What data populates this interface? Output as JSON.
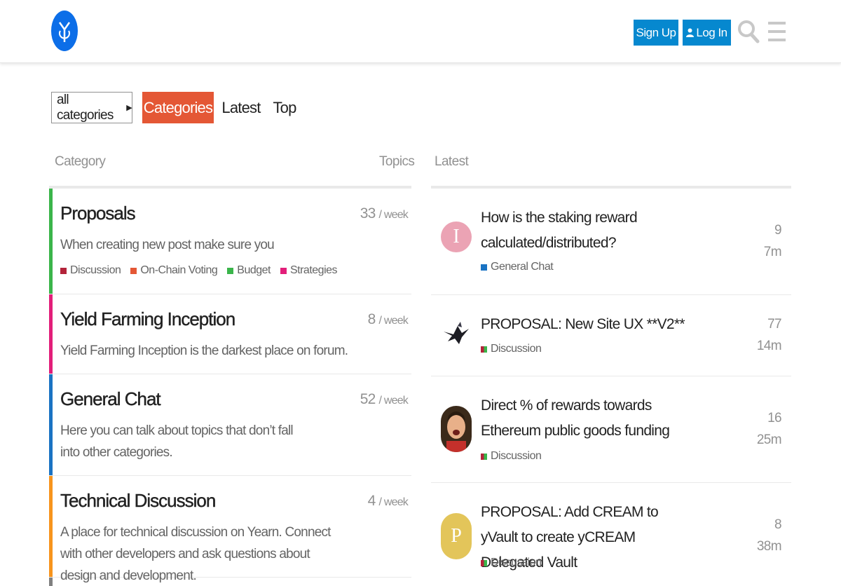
{
  "header": {
    "logo_icon": "yearn-logo-icon",
    "signup_label": "Sign Up",
    "login_label": "Log In",
    "brand_color": "#0688cf"
  },
  "nav": {
    "category_dropdown": "all categories",
    "tabs": [
      {
        "label": "Categories",
        "active": true
      },
      {
        "label": "Latest",
        "active": false
      },
      {
        "label": "Top",
        "active": false
      }
    ],
    "active_color": "#e45735"
  },
  "categories_table": {
    "col_category": "Category",
    "col_topics": "Topics",
    "rows": [
      {
        "name": "Proposals",
        "count": "33",
        "unit": "/ week",
        "color": "#3ab54a",
        "desc": "When creating new post make sure you",
        "subcategories": [
          {
            "label": "Discussion",
            "color": "#b3233a"
          },
          {
            "label": "On-Chain Voting",
            "color": "#e45735"
          },
          {
            "label": "Budget",
            "color": "#3ab54a"
          },
          {
            "label": "Strategies",
            "color": "#e21e7a"
          }
        ]
      },
      {
        "name": "Yield Farming Inception",
        "count": "8",
        "unit": "/ week",
        "color": "#e21e7a",
        "desc": "Yield Farming Inception is the darkest place on forum."
      },
      {
        "name": "General Chat",
        "count": "52",
        "unit": "/ week",
        "color": "#1a73c3",
        "desc": "Here you can talk about topics that don’t fall into other categories."
      },
      {
        "name": "Technical Discussion",
        "count": "4",
        "unit": "/ week",
        "color": "#f7941d",
        "desc": "A place for technical discussion on Yearn. Connect with other developers and ask questions about design and development."
      }
    ]
  },
  "latest": {
    "header": "Latest",
    "topics": [
      {
        "title": "How is the staking reward calculated/distributed?",
        "category": "General Chat",
        "category_color": "#1a73c3",
        "posts": "9",
        "age": "7m",
        "avatar_letter": "I",
        "avatar_color": "#eba3b4"
      },
      {
        "title": "PROPOSAL: New Site UX **V2**",
        "category": "Discussion",
        "category_colors": [
          "#b3233a",
          "#3ab54a"
        ],
        "posts": "77",
        "age": "14m",
        "avatar_icon": "bird-avatar-icon"
      },
      {
        "title": "Direct % of rewards towards Ethereum public goods funding",
        "category": "Discussion",
        "category_colors": [
          "#b3233a",
          "#3ab54a"
        ],
        "posts": "16",
        "age": "25m",
        "avatar_icon": "user-photo-avatar-icon"
      },
      {
        "title": "PROPOSAL: Add CREAM to yVault to create yCREAM Delegated Vault",
        "category": "Discussion",
        "category_colors": [
          "#b3233a",
          "#3ab54a"
        ],
        "posts": "8",
        "age": "38m",
        "avatar_letter": "P",
        "avatar_color": "#e3c55a"
      }
    ]
  }
}
